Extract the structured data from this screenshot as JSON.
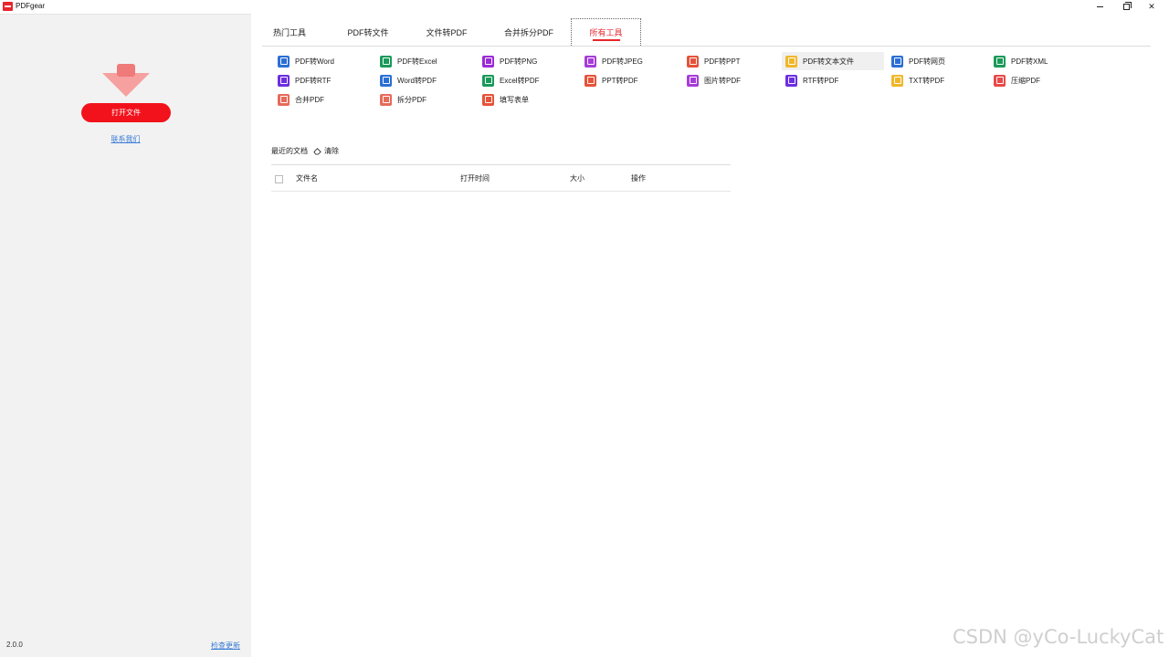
{
  "window": {
    "title": "PDFgear",
    "controls": {
      "minimize": "minimize-icon",
      "maximize": "maximize-icon",
      "close": "close-icon"
    }
  },
  "sidebar": {
    "open_button": "打开文件",
    "contact_link": "联系我们",
    "version": "2.0.0",
    "update_link": "检查更新"
  },
  "tabs": [
    {
      "label": "热门工具"
    },
    {
      "label": "PDF转文件"
    },
    {
      "label": "文件转PDF"
    },
    {
      "label": "合并拆分PDF"
    },
    {
      "label": "所有工具",
      "active": true
    }
  ],
  "tools": [
    {
      "label": "PDF转Word",
      "color": "#2b6fd6",
      "icon": "pdf-to-word-icon"
    },
    {
      "label": "PDF转Excel",
      "color": "#1a9a5a",
      "icon": "pdf-to-excel-icon"
    },
    {
      "label": "PDF转PNG",
      "color": "#9b2bd6",
      "icon": "pdf-to-png-icon"
    },
    {
      "label": "PDF转JPEG",
      "color": "#a73cd8",
      "icon": "pdf-to-jpeg-icon"
    },
    {
      "label": "PDF转PPT",
      "color": "#e5533a",
      "icon": "pdf-to-ppt-icon"
    },
    {
      "label": "PDF转文本文件",
      "color": "#f0b72a",
      "icon": "pdf-to-text-icon",
      "highlighted": true
    },
    {
      "label": "PDF转网页",
      "color": "#2b6fd6",
      "icon": "pdf-to-html-icon"
    },
    {
      "label": "PDF转XML",
      "color": "#1a9a5a",
      "icon": "pdf-to-xml-icon"
    },
    {
      "label": "PDF转RTF",
      "color": "#6d2ee0",
      "icon": "pdf-to-rtf-icon"
    },
    {
      "label": "Word转PDF",
      "color": "#2b6fd6",
      "icon": "word-to-pdf-icon"
    },
    {
      "label": "Excel转PDF",
      "color": "#1a9a5a",
      "icon": "excel-to-pdf-icon"
    },
    {
      "label": "PPT转PDF",
      "color": "#e5533a",
      "icon": "ppt-to-pdf-icon"
    },
    {
      "label": "图片转PDF",
      "color": "#a73cd8",
      "icon": "image-to-pdf-icon"
    },
    {
      "label": "RTF转PDF",
      "color": "#6d2ee0",
      "icon": "rtf-to-pdf-icon"
    },
    {
      "label": "TXT转PDF",
      "color": "#f0b72a",
      "icon": "txt-to-pdf-icon"
    },
    {
      "label": "压缩PDF",
      "color": "#e84a4a",
      "icon": "compress-pdf-icon"
    },
    {
      "label": "合并PDF",
      "color": "#e86a5a",
      "icon": "merge-pdf-icon"
    },
    {
      "label": "拆分PDF",
      "color": "#e86a5a",
      "icon": "split-pdf-icon"
    },
    {
      "label": "填写表单",
      "color": "#e5533a",
      "icon": "fill-form-icon"
    }
  ],
  "recent": {
    "title": "最近的文档",
    "clear": "清除",
    "columns": {
      "name": "文件名",
      "time": "打开时间",
      "size": "大小",
      "action": "操作"
    },
    "rows": []
  },
  "watermark": "CSDN @yCo-LuckyCat",
  "colors": {
    "accent": "#e8262c",
    "sidebar_bg": "#f2f2f2",
    "link": "#3a7bd5"
  }
}
